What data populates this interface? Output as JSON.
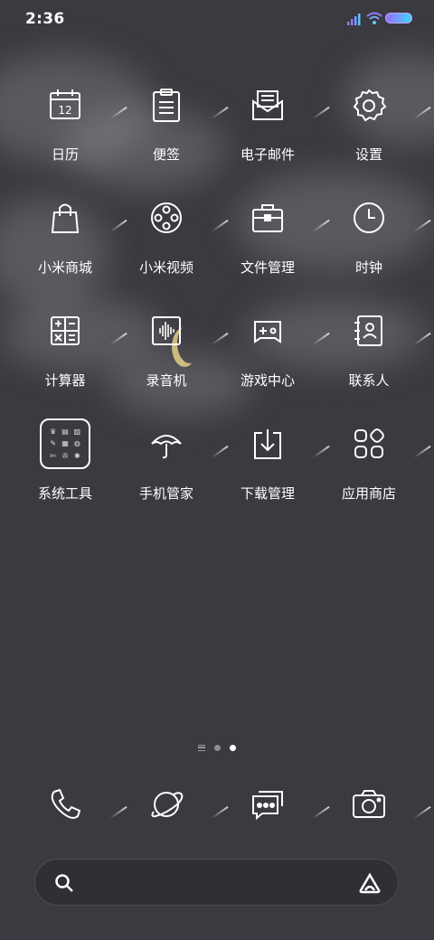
{
  "status": {
    "time": "2:36"
  },
  "apps": [
    {
      "id": "calendar",
      "label": "日历",
      "icon": "calendar-icon",
      "day": "12"
    },
    {
      "id": "notes",
      "label": "便签",
      "icon": "notes-icon"
    },
    {
      "id": "email",
      "label": "电子邮件",
      "icon": "email-icon"
    },
    {
      "id": "settings",
      "label": "设置",
      "icon": "gear-icon"
    },
    {
      "id": "mall",
      "label": "小米商城",
      "icon": "shopping-bag-icon"
    },
    {
      "id": "video",
      "label": "小米视频",
      "icon": "film-reel-icon"
    },
    {
      "id": "files",
      "label": "文件管理",
      "icon": "briefcase-icon"
    },
    {
      "id": "clock",
      "label": "时钟",
      "icon": "clock-icon"
    },
    {
      "id": "calculator",
      "label": "计算器",
      "icon": "calculator-icon"
    },
    {
      "id": "recorder",
      "label": "录音机",
      "icon": "waveform-icon"
    },
    {
      "id": "game",
      "label": "游戏中心",
      "icon": "gamepad-icon"
    },
    {
      "id": "contacts",
      "label": "联系人",
      "icon": "contact-card-icon"
    },
    {
      "id": "tools",
      "label": "系统工具",
      "icon": "folder-icon"
    },
    {
      "id": "security",
      "label": "手机管家",
      "icon": "umbrella-icon"
    },
    {
      "id": "downloads",
      "label": "下载管理",
      "icon": "download-icon"
    },
    {
      "id": "store",
      "label": "应用商店",
      "icon": "app-grid-icon"
    }
  ],
  "dock": [
    {
      "id": "phone",
      "icon": "phone-icon"
    },
    {
      "id": "browser",
      "icon": "planet-icon"
    },
    {
      "id": "messages",
      "icon": "chat-bubble-icon"
    },
    {
      "id": "camera",
      "icon": "camera-icon"
    }
  ],
  "pages": {
    "count": 3,
    "active": 2
  },
  "search": {
    "icon": "search-icon",
    "assistant_icon": "assistant-icon"
  },
  "colors": {
    "background": "#3a3a40",
    "battery_start": "#9a6cff",
    "battery_end": "#40d6ff",
    "moon": "#e2cf86"
  }
}
